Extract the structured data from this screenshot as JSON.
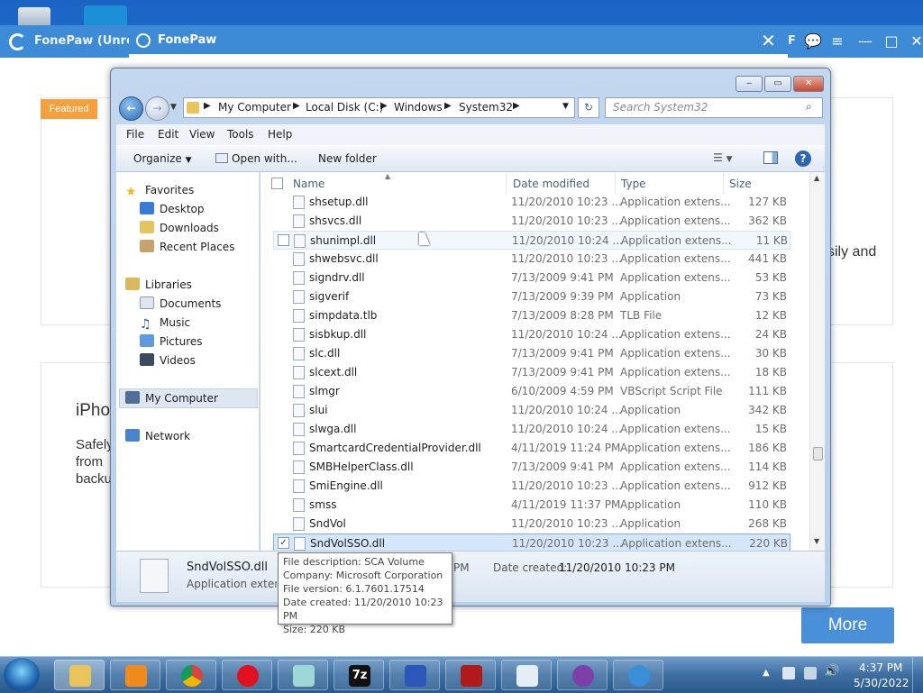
{
  "background_app": {
    "title1": "FonePaw (Unreg",
    "title2": "FonePaw",
    "featured": "Featured",
    "text_right": "sily and",
    "iphone_label": "iPho",
    "line1": "Safely",
    "line2": "from",
    "line3": "backu",
    "more_button": "More",
    "title_letter": "F"
  },
  "explorer": {
    "breadcrumb": [
      "My Computer",
      "Local Disk (C:)",
      "Windows",
      "System32"
    ],
    "search_placeholder": "Search System32",
    "menu": [
      "File",
      "Edit",
      "View",
      "Tools",
      "Help"
    ],
    "toolbar": {
      "organize": "Organize",
      "open_with": "Open with...",
      "new_folder": "New folder"
    },
    "nav": {
      "favorites": "Favorites",
      "desktop": "Desktop",
      "downloads": "Downloads",
      "recent": "Recent Places",
      "libraries": "Libraries",
      "documents": "Documents",
      "music": "Music",
      "pictures": "Pictures",
      "videos": "Videos",
      "my_computer": "My Computer",
      "network": "Network"
    },
    "columns": {
      "name": "Name",
      "date": "Date modified",
      "type": "Type",
      "size": "Size"
    },
    "files": [
      {
        "name": "shsetup.dll",
        "date": "11/20/2010 10:23 ...",
        "type": "Application extens...",
        "size": "127 KB"
      },
      {
        "name": "shsvcs.dll",
        "date": "11/20/2010 10:23 ...",
        "type": "Application extens...",
        "size": "362 KB"
      },
      {
        "name": "shunimpl.dll",
        "date": "11/20/2010 10:24 ...",
        "type": "Application extens...",
        "size": "11 KB"
      },
      {
        "name": "shwebsvc.dll",
        "date": "11/20/2010 10:23 ...",
        "type": "Application extens...",
        "size": "441 KB"
      },
      {
        "name": "signdrv.dll",
        "date": "7/13/2009 9:41 PM",
        "type": "Application extens...",
        "size": "53 KB"
      },
      {
        "name": "sigverif",
        "date": "7/13/2009 9:39 PM",
        "type": "Application",
        "size": "73 KB"
      },
      {
        "name": "simpdata.tlb",
        "date": "7/13/2009 8:28 PM",
        "type": "TLB File",
        "size": "12 KB"
      },
      {
        "name": "sisbkup.dll",
        "date": "11/20/2010 10:24 ...",
        "type": "Application extens...",
        "size": "24 KB"
      },
      {
        "name": "slc.dll",
        "date": "7/13/2009 9:41 PM",
        "type": "Application extens...",
        "size": "30 KB"
      },
      {
        "name": "slcext.dll",
        "date": "7/13/2009 9:41 PM",
        "type": "Application extens...",
        "size": "18 KB"
      },
      {
        "name": "slmgr",
        "date": "6/10/2009 4:59 PM",
        "type": "VBScript Script File",
        "size": "111 KB"
      },
      {
        "name": "slui",
        "date": "11/20/2010 10:24 ...",
        "type": "Application",
        "size": "342 KB"
      },
      {
        "name": "slwga.dll",
        "date": "11/20/2010 10:24 ...",
        "type": "Application extens...",
        "size": "15 KB"
      },
      {
        "name": "SmartcardCredentialProvider.dll",
        "date": "4/11/2019 11:24 PM",
        "type": "Application extens...",
        "size": "186 KB"
      },
      {
        "name": "SMBHelperClass.dll",
        "date": "7/13/2009 9:41 PM",
        "type": "Application extens...",
        "size": "114 KB"
      },
      {
        "name": "SmiEngine.dll",
        "date": "11/20/2010 10:23 ...",
        "type": "Application extens...",
        "size": "912 KB"
      },
      {
        "name": "smss",
        "date": "4/11/2019 11:37 PM",
        "type": "Application",
        "size": "110 KB"
      },
      {
        "name": "SndVol",
        "date": "11/20/2010 10:23 ...",
        "type": "Application",
        "size": "268 KB"
      },
      {
        "name": "SndVolSSO.dll",
        "date": "11/20/2010 10:23 ...",
        "type": "Application extens...",
        "size": "220 KB"
      }
    ],
    "details": {
      "file_name": "SndVolSSO.dll",
      "file_type": "Application extensi",
      "modified_tail": "PM",
      "date_created_label": "Date created:",
      "date_created": "11/20/2010 10:23 PM"
    },
    "tooltip": [
      "File description: SCA Volume",
      "Company: Microsoft Corporation",
      "File version: 6.1.7601.17514",
      "Date created: 11/20/2010 10:23 PM",
      "Size: 220 KB"
    ]
  },
  "taskbar": {
    "clock_time": "4:37 PM",
    "clock_date": "5/30/2022"
  }
}
